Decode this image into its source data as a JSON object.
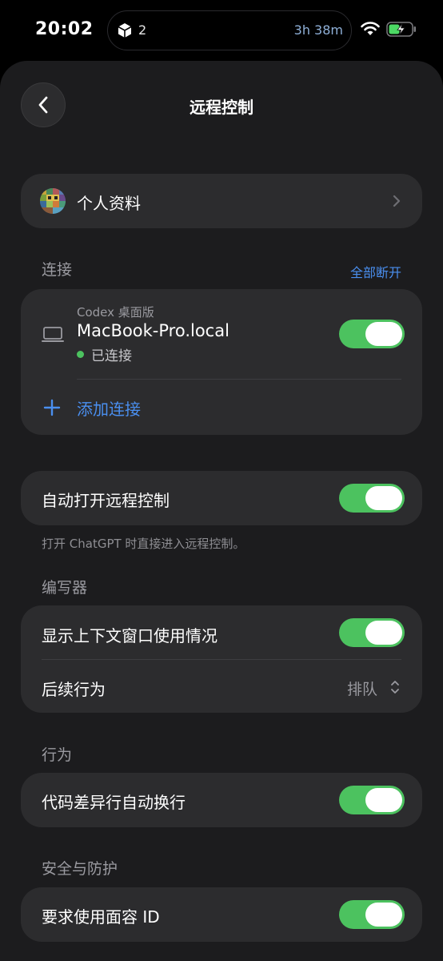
{
  "status_bar": {
    "time": "20:02",
    "island_count": "2",
    "island_timer": "3h 38m"
  },
  "header": {
    "title": "远程控制"
  },
  "profile": {
    "label": "个人资料"
  },
  "connections": {
    "section_label": "连接",
    "disconnect_all": "全部断开",
    "device_type": "Codex 桌面版",
    "device_name": "MacBook-Pro.local",
    "status": "已连接",
    "enabled": true,
    "add_label": "添加连接"
  },
  "auto_open": {
    "label": "自动打开远程控制",
    "enabled": true,
    "footnote": "打开 ChatGPT 时直接进入远程控制。"
  },
  "editor": {
    "section_label": "编写器",
    "context_label": "显示上下文窗口使用情况",
    "context_enabled": true,
    "followup_label": "后续行为",
    "followup_value": "排队"
  },
  "behavior": {
    "section_label": "行为",
    "wrap_label": "代码差异行自动换行",
    "wrap_enabled": true
  },
  "security": {
    "section_label": "安全与防护",
    "faceid_label": "要求使用面容 ID",
    "faceid_enabled": true
  },
  "colors": {
    "toggle_on": "#4cc25f",
    "accent": "#4a8ff0",
    "card": "#2c2c2e",
    "sheet": "#1c1c1e"
  }
}
